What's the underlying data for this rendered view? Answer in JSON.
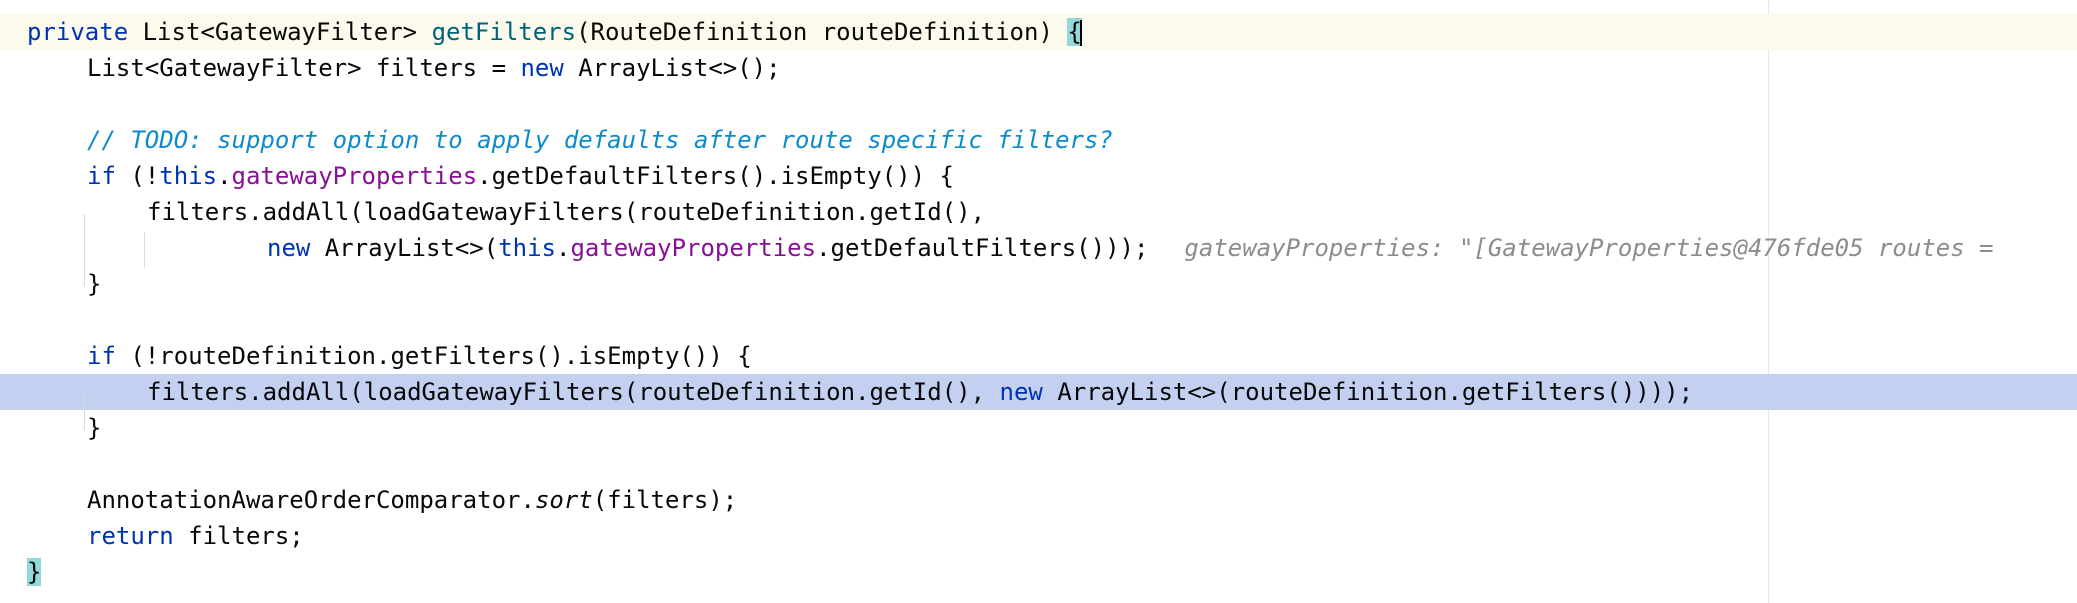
{
  "editor": {
    "lines": [
      {
        "indent": "",
        "tokens": [
          {
            "t": "private ",
            "c": "kw"
          },
          {
            "t": "List<GatewayFilter> ",
            "c": ""
          },
          {
            "t": "getFilters",
            "c": "method"
          },
          {
            "t": "(RouteDefinition routeDefinition) ",
            "c": ""
          },
          {
            "t": "{",
            "c": "brace-match"
          }
        ]
      },
      {
        "indent": "",
        "tokens": [
          {
            "t": "List<GatewayFilter> filters = ",
            "c": ""
          },
          {
            "t": "new ",
            "c": "kw"
          },
          {
            "t": "ArrayList<>();",
            "c": ""
          }
        ]
      },
      {
        "indent": "",
        "tokens": []
      },
      {
        "indent": "",
        "tokens": [
          {
            "t": "// TODO: support option to apply defaults after route specific filters?",
            "c": "comment"
          }
        ]
      },
      {
        "indent": "",
        "tokens": [
          {
            "t": "if ",
            "c": "kw"
          },
          {
            "t": "(!",
            "c": ""
          },
          {
            "t": "this",
            "c": "kw"
          },
          {
            "t": ".",
            "c": ""
          },
          {
            "t": "gatewayProperties",
            "c": "field"
          },
          {
            "t": ".getDefaultFilters().isEmpty()) {",
            "c": ""
          }
        ]
      },
      {
        "indent": "",
        "tokens": [
          {
            "t": "filters.addAll(loadGatewayFilters(routeDefinition.getId(),",
            "c": ""
          }
        ]
      },
      {
        "indent": "",
        "tokens": [
          {
            "t": "new ",
            "c": "kw"
          },
          {
            "t": "ArrayList<>(",
            "c": ""
          },
          {
            "t": "this",
            "c": "kw"
          },
          {
            "t": ".",
            "c": ""
          },
          {
            "t": "gatewayProperties",
            "c": "field"
          },
          {
            "t": ".getDefaultFilters()));",
            "c": ""
          }
        ]
      },
      {
        "indent": "",
        "tokens": [
          {
            "t": "}",
            "c": ""
          }
        ]
      },
      {
        "indent": "",
        "tokens": []
      },
      {
        "indent": "",
        "tokens": [
          {
            "t": "if ",
            "c": "kw"
          },
          {
            "t": "(!routeDefinition.getFilters().isEmpty()) {",
            "c": ""
          }
        ]
      },
      {
        "indent": "",
        "tokens": [
          {
            "t": "filters.addAll(loadGatewayFilters(routeDefinition.getId(), ",
            "c": ""
          },
          {
            "t": "new ",
            "c": "kw"
          },
          {
            "t": "ArrayList<>(routeDefinition.getFilters())));",
            "c": ""
          }
        ]
      },
      {
        "indent": "",
        "tokens": [
          {
            "t": "}",
            "c": ""
          }
        ]
      },
      {
        "indent": "",
        "tokens": []
      },
      {
        "indent": "",
        "tokens": [
          {
            "t": "AnnotationAwareOrderComparator.",
            "c": ""
          },
          {
            "t": "sort",
            "c": "italic"
          },
          {
            "t": "(filters);",
            "c": ""
          }
        ]
      },
      {
        "indent": "",
        "tokens": [
          {
            "t": "return ",
            "c": "kw"
          },
          {
            "t": "filters;",
            "c": ""
          }
        ]
      },
      {
        "indent": "",
        "tokens": [
          {
            "t": "}",
            "c": "brace-match"
          }
        ]
      }
    ],
    "inline_hint": "gatewayProperties: \"[GatewayProperties@476fde05 routes =",
    "colors": {
      "keyword": "#0033b3",
      "method": "#00627a",
      "field": "#871094",
      "comment": "#0b8bcc",
      "hint": "#8c8c8c",
      "current_line_bg": "#fcfaed",
      "execution_line_bg": "#c3d0f0",
      "brace_match_bg": "#93d9d9"
    }
  }
}
